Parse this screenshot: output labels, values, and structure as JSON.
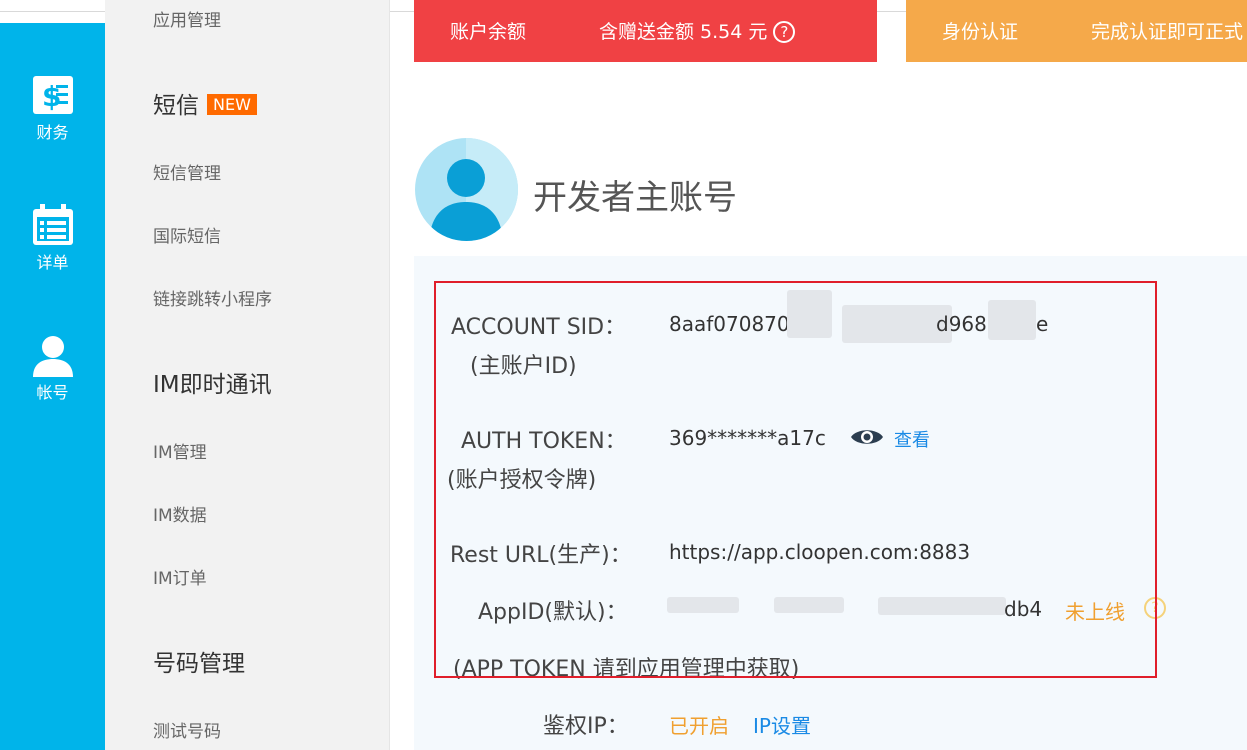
{
  "rail": {
    "finance_label": "财务",
    "detail_label": "详单",
    "account_label": "帐号"
  },
  "submenu": {
    "app_manage": "应用管理",
    "sms_head": "短信",
    "new_badge": "NEW",
    "sms_manage": "短信管理",
    "intl_sms": "国际短信",
    "link_jump": "链接跳转小程序",
    "im_head": "IM即时通讯",
    "im_manage": "IM管理",
    "im_data": "IM数据",
    "im_order": "IM订单",
    "number_head": "号码管理",
    "test_number": "测试号码"
  },
  "banner": {
    "balance_label": "账户余额",
    "gift_amount": "含赠送金额 5.54 元",
    "help_symbol": "?",
    "id_auth": "身份认证",
    "id_auth_desc": "完成认证即可正式"
  },
  "main": {
    "title": "开发者主账号",
    "account_sid_label": "ACCOUNT SID：",
    "account_sid_sub": "(主账户ID)",
    "account_sid_value_a": "8aaf070870f",
    "account_sid_value_b": "d96806",
    "account_sid_value_c": "e",
    "auth_token_label": "AUTH TOKEN：",
    "auth_token_sub": "(账户授权令牌)",
    "auth_token_value": "369*******a17c",
    "view_link": "查看",
    "rest_url_label": "Rest URL(生产)：",
    "rest_url_value": "https://app.cloopen.com:8883",
    "appid_label": "AppID(默认)：",
    "appid_value_tail": "db4",
    "appid_status": "未上线",
    "app_token_note": "(APP TOKEN 请到应用管理中获取)",
    "auth_ip_label": "鉴权IP：",
    "auth_ip_status": "已开启",
    "ip_settings": "IP设置"
  },
  "colors": {
    "rail": "#00b4ea",
    "banner_red": "#f04144",
    "banner_orange": "#f5a94a",
    "highlight_box": "#e01e2b",
    "link": "#1a8ae5",
    "status": "#f0a030"
  },
  "icons": [
    "finance-icon",
    "calendar-list-icon",
    "user-icon",
    "eye-icon",
    "question-circle-icon",
    "avatar-icon"
  ]
}
